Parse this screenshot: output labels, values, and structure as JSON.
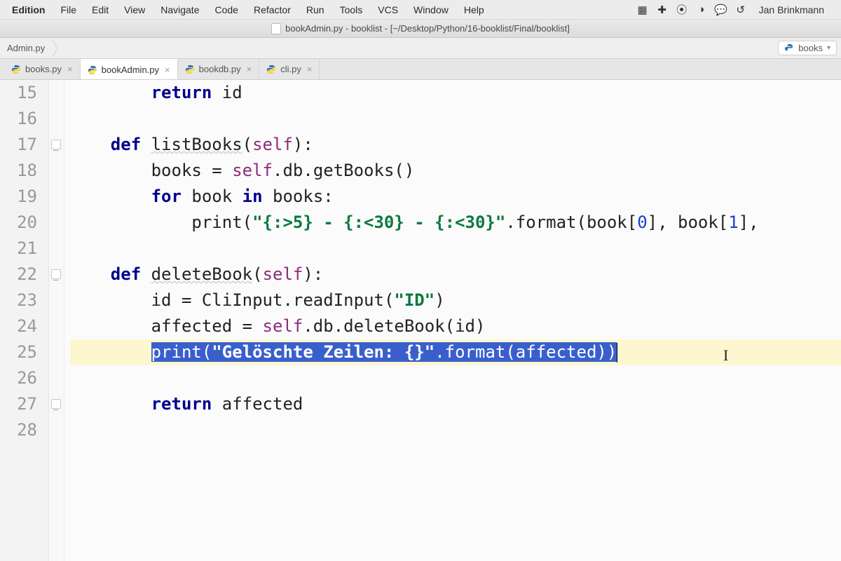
{
  "menu": {
    "items": [
      "Edition",
      "File",
      "Edit",
      "View",
      "Navigate",
      "Code",
      "Refactor",
      "Run",
      "Tools",
      "VCS",
      "Window",
      "Help"
    ],
    "user": "Jan Brinkmann"
  },
  "titlebar": {
    "text": "bookAdmin.py - booklist - [~/Desktop/Python/16-booklist/Final/booklist]"
  },
  "breadcrumb": {
    "item": "Admin.py"
  },
  "config_selector": {
    "label": "books"
  },
  "tabs": [
    {
      "label": "books.py",
      "active": false
    },
    {
      "label": "bookAdmin.py",
      "active": true
    },
    {
      "label": "bookdb.py",
      "active": false
    },
    {
      "label": "cli.py",
      "active": false
    }
  ],
  "code": {
    "first_line_no": 15,
    "lines": [
      {
        "n": 15,
        "indent": 8,
        "tokens": [
          [
            "kw",
            "return"
          ],
          [
            "sp",
            " "
          ],
          [
            "name",
            "id"
          ]
        ]
      },
      {
        "n": 16,
        "indent": 0,
        "tokens": []
      },
      {
        "n": 17,
        "indent": 4,
        "fold": true,
        "tokens": [
          [
            "kw",
            "def"
          ],
          [
            "sp",
            " "
          ],
          [
            "fn underline",
            "listBooks"
          ],
          [
            "op",
            "("
          ],
          [
            "self",
            "self"
          ],
          [
            "op",
            "):"
          ]
        ]
      },
      {
        "n": 18,
        "indent": 8,
        "tokens": [
          [
            "name",
            "books "
          ],
          [
            "op",
            "= "
          ],
          [
            "self",
            "self"
          ],
          [
            "op",
            "."
          ],
          [
            "name",
            "db"
          ],
          [
            "op",
            "."
          ],
          [
            "name",
            "getBooks"
          ],
          [
            "op",
            "()"
          ]
        ]
      },
      {
        "n": 19,
        "indent": 8,
        "tokens": [
          [
            "kw",
            "for"
          ],
          [
            "sp",
            " "
          ],
          [
            "name",
            "book"
          ],
          [
            "sp",
            " "
          ],
          [
            "kw",
            "in"
          ],
          [
            "sp",
            " "
          ],
          [
            "name",
            "books"
          ],
          [
            "op",
            ":"
          ]
        ]
      },
      {
        "n": 20,
        "indent": 12,
        "tokens": [
          [
            "name",
            "print"
          ],
          [
            "op",
            "("
          ],
          [
            "str",
            "\"{:>5} - {:<30} - {:<30}\""
          ],
          [
            "op",
            "."
          ],
          [
            "name",
            "format"
          ],
          [
            "op",
            "("
          ],
          [
            "name",
            "book"
          ],
          [
            "op",
            "["
          ],
          [
            "num",
            "0"
          ],
          [
            "op",
            "], "
          ],
          [
            "name",
            "book"
          ],
          [
            "op",
            "["
          ],
          [
            "num",
            "1"
          ],
          [
            "op",
            "],"
          ]
        ]
      },
      {
        "n": 21,
        "indent": 0,
        "tokens": []
      },
      {
        "n": 22,
        "indent": 4,
        "fold": true,
        "tokens": [
          [
            "kw",
            "def"
          ],
          [
            "sp",
            " "
          ],
          [
            "fn underline",
            "deleteBook"
          ],
          [
            "op",
            "("
          ],
          [
            "self",
            "self"
          ],
          [
            "op",
            "):"
          ]
        ]
      },
      {
        "n": 23,
        "indent": 8,
        "tokens": [
          [
            "name",
            "id "
          ],
          [
            "op",
            "= "
          ],
          [
            "name",
            "CliInput"
          ],
          [
            "op",
            "."
          ],
          [
            "name",
            "readInput"
          ],
          [
            "op",
            "("
          ],
          [
            "str",
            "\"ID\""
          ],
          [
            "op",
            ")"
          ]
        ]
      },
      {
        "n": 24,
        "indent": 8,
        "tokens": [
          [
            "name",
            "affected "
          ],
          [
            "op",
            "= "
          ],
          [
            "self",
            "self"
          ],
          [
            "op",
            "."
          ],
          [
            "name",
            "db"
          ],
          [
            "op",
            "."
          ],
          [
            "name",
            "deleteBook"
          ],
          [
            "op",
            "("
          ],
          [
            "name",
            "id"
          ],
          [
            "op",
            ")"
          ]
        ]
      },
      {
        "n": 25,
        "indent": 8,
        "hl": true,
        "sel": true,
        "tokens": [
          [
            "name",
            "print"
          ],
          [
            "op",
            "("
          ],
          [
            "str",
            "\"Gelöschte Zeilen: {}\""
          ],
          [
            "op",
            "."
          ],
          [
            "name",
            "format"
          ],
          [
            "op",
            "("
          ],
          [
            "name",
            "affected"
          ],
          [
            "op",
            "))"
          ]
        ]
      },
      {
        "n": 26,
        "indent": 0,
        "tokens": []
      },
      {
        "n": 27,
        "indent": 8,
        "fold": true,
        "tokens": [
          [
            "kw",
            "return"
          ],
          [
            "sp",
            " "
          ],
          [
            "name",
            "affected"
          ]
        ]
      },
      {
        "n": 28,
        "indent": 0,
        "tokens": []
      }
    ],
    "ibeam_at_line": 25
  }
}
